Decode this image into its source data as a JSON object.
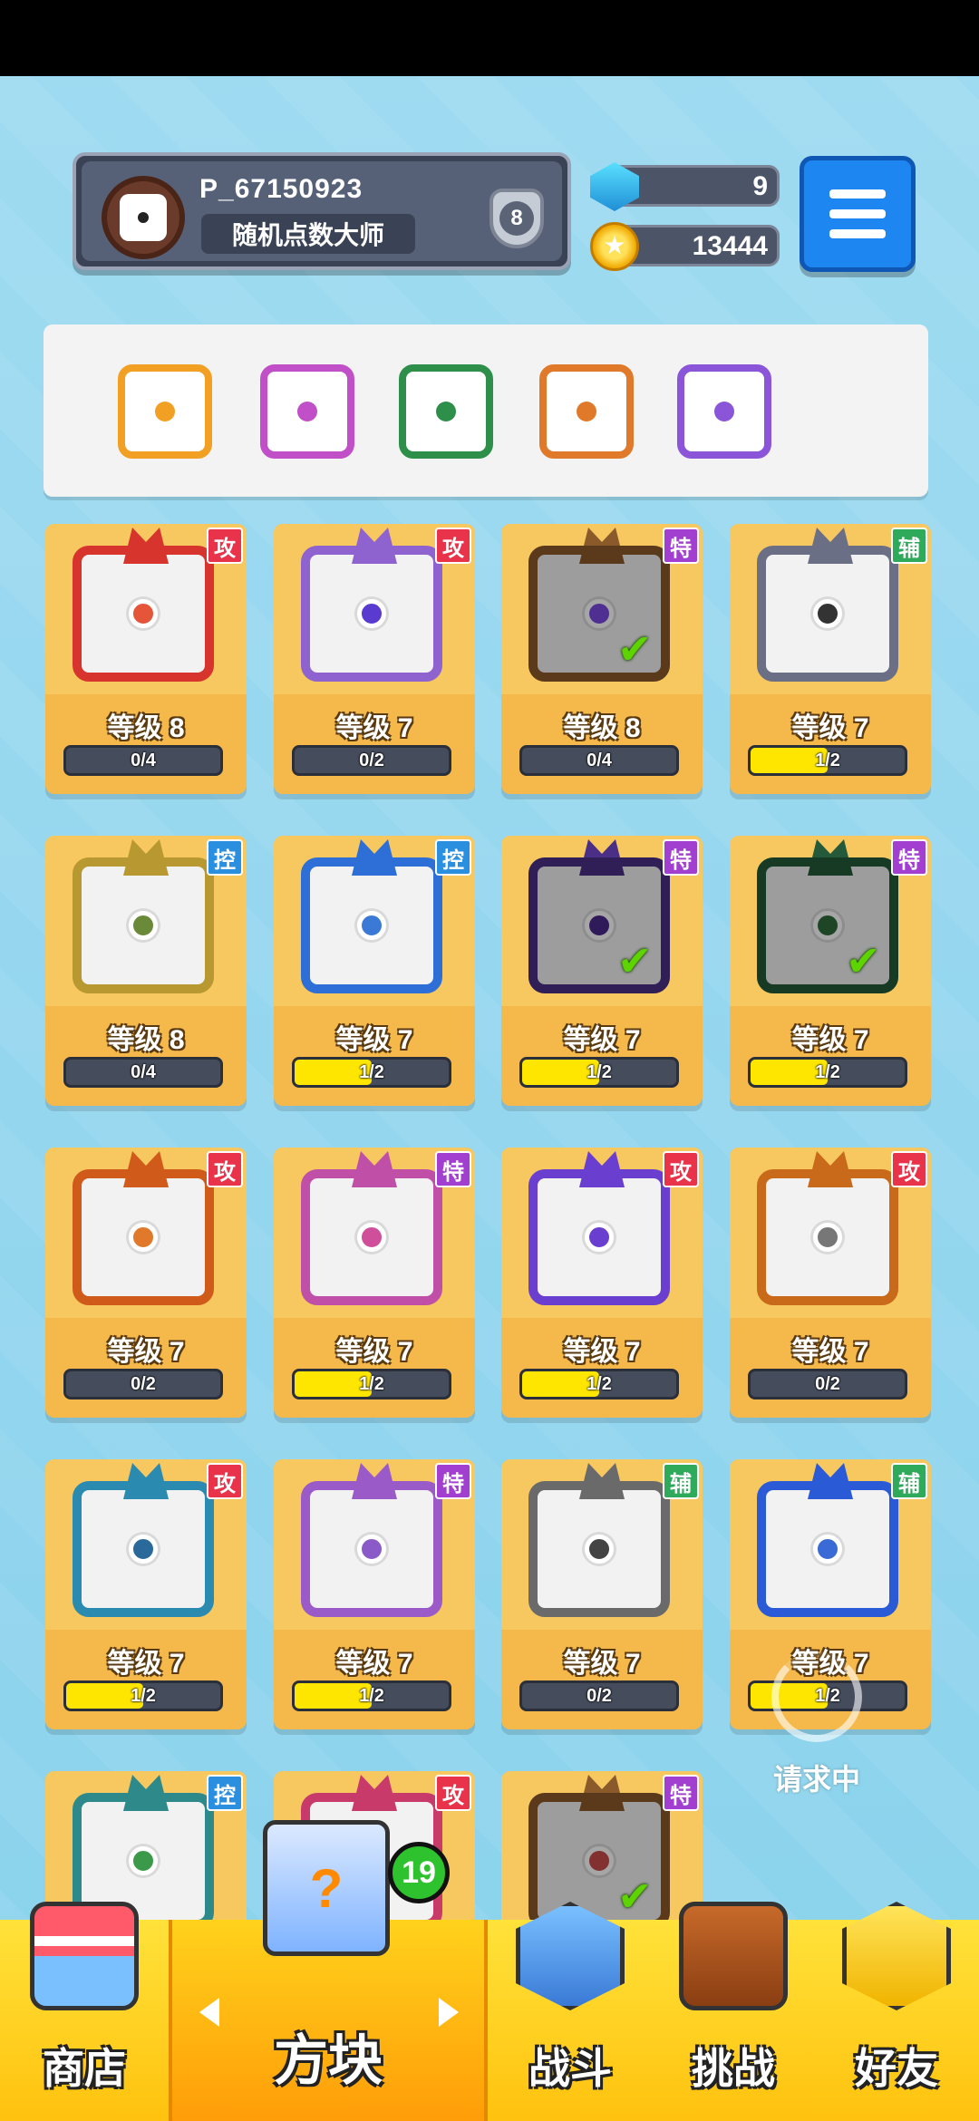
{
  "player": {
    "id": "P_67150923",
    "title": "随机点数大师",
    "rank": "8"
  },
  "currency": {
    "gems": "9",
    "coins": "13444"
  },
  "deck": [
    {
      "color": "#f2a024",
      "icon": "heart-dice-icon"
    },
    {
      "color": "#c04fc8",
      "icon": "rainbow-dice-icon"
    },
    {
      "color": "#2e8f4a",
      "icon": "pentagram-dice-icon"
    },
    {
      "color": "#e07a2a",
      "icon": "infinity-dice-icon"
    },
    {
      "color": "#8a55d8",
      "icon": "diamond-dice-icon"
    }
  ],
  "cards": [
    {
      "level": "等级 8",
      "progress": "0/4",
      "fill": 0,
      "tag": "攻",
      "tag_color": "#e8334a",
      "frame": "#d6342c",
      "core": "#e4553a",
      "checked": false,
      "icon": "star-burst-dice-icon"
    },
    {
      "level": "等级 7",
      "progress": "0/2",
      "fill": 0,
      "tag": "攻",
      "tag_color": "#e8334a",
      "frame": "#8e62cf",
      "core": "#5a3bd0",
      "checked": false,
      "icon": "magic-circle-dice-icon"
    },
    {
      "level": "等级 8",
      "progress": "0/4",
      "fill": 0,
      "tag": "特",
      "tag_color": "#a23fd0",
      "frame": "#8a5a2a",
      "core": "#7a4be0",
      "checked": true,
      "icon": "infinity-dice-icon"
    },
    {
      "level": "等级 7",
      "progress": "1/2",
      "fill": 0.5,
      "tag": "辅",
      "tag_color": "#2eaa5a",
      "frame": "#6b6f86",
      "core": "#333333",
      "checked": false,
      "icon": "jaw-dice-icon"
    },
    {
      "level": "等级 8",
      "progress": "0/4",
      "fill": 0,
      "tag": "控",
      "tag_color": "#2b8fe0",
      "frame": "#b89830",
      "core": "#6a8a3a",
      "checked": false,
      "icon": "shield-dice-icon"
    },
    {
      "level": "等级 7",
      "progress": "1/2",
      "fill": 0.5,
      "tag": "控",
      "tag_color": "#2b8fe0",
      "frame": "#2d6fd6",
      "core": "#3a7ad6",
      "checked": false,
      "icon": "snowflake-dice-icon"
    },
    {
      "level": "等级 7",
      "progress": "1/2",
      "fill": 0.5,
      "tag": "特",
      "tag_color": "#a23fd0",
      "frame": "#4b2e86",
      "core": "#4a2a8a",
      "checked": true,
      "icon": "diamond-dice-icon"
    },
    {
      "level": "等级 7",
      "progress": "1/2",
      "fill": 0.5,
      "tag": "特",
      "tag_color": "#a23fd0",
      "frame": "#245a3a",
      "core": "#2e6a3a",
      "checked": true,
      "icon": "pentagram-dice-icon"
    },
    {
      "level": "等级 7",
      "progress": "0/2",
      "fill": 0,
      "tag": "攻",
      "tag_color": "#e8334a",
      "frame": "#d05a1a",
      "core": "#e07a2a",
      "checked": false,
      "icon": "flame-dice-icon"
    },
    {
      "level": "等级 7",
      "progress": "1/2",
      "fill": 0.5,
      "tag": "特",
      "tag_color": "#a23fd0",
      "frame": "#c04fa8",
      "core": "#d04f9a",
      "checked": false,
      "icon": "syringe-dice-icon"
    },
    {
      "level": "等级 7",
      "progress": "1/2",
      "fill": 0.5,
      "tag": "攻",
      "tag_color": "#e8334a",
      "frame": "#6a3fd0",
      "core": "#6a3fd0",
      "checked": false,
      "icon": "orbit-dice-icon"
    },
    {
      "level": "等级 7",
      "progress": "0/2",
      "fill": 0,
      "tag": "攻",
      "tag_color": "#e8334a",
      "frame": "#c86a1a",
      "core": "#777777",
      "checked": false,
      "icon": "gun-dice-icon"
    },
    {
      "level": "等级 7",
      "progress": "1/2",
      "fill": 0.5,
      "tag": "攻",
      "tag_color": "#e8334a",
      "frame": "#2a8ab0",
      "core": "#2a6a9a",
      "checked": false,
      "icon": "whirlwind-dice-icon"
    },
    {
      "level": "等级 7",
      "progress": "1/2",
      "fill": 0.5,
      "tag": "特",
      "tag_color": "#a23fd0",
      "frame": "#9a5ac8",
      "core": "#8a5ac8",
      "checked": false,
      "icon": "bubble-dice-icon"
    },
    {
      "level": "等级 7",
      "progress": "0/2",
      "fill": 0,
      "tag": "辅",
      "tag_color": "#2eaa5a",
      "frame": "#6a6a6a",
      "core": "#444444",
      "checked": false,
      "icon": "clock-dice-icon"
    },
    {
      "level": "等级 7",
      "progress": "1/2",
      "fill": 0.5,
      "tag": "辅",
      "tag_color": "#2eaa5a",
      "frame": "#2a5ad6",
      "core": "#3a6ad6",
      "checked": false,
      "icon": "moon-dice-icon"
    },
    {
      "level": "",
      "progress": "",
      "fill": 0,
      "tag": "控",
      "tag_color": "#2b8fe0",
      "frame": "#2e8a8a",
      "core": "#3a9a4a",
      "checked": false,
      "icon": "wave-dice-icon"
    },
    {
      "level": "",
      "progress": "",
      "fill": 0,
      "tag": "攻",
      "tag_color": "#e8334a",
      "frame": "#c83a6a",
      "core": "#555555",
      "checked": false,
      "icon": "saw-dice-icon"
    },
    {
      "level": "",
      "progress": "",
      "fill": 0,
      "tag": "特",
      "tag_color": "#a23fd0",
      "frame": "#8a5a2a",
      "core": "#c84a4a",
      "checked": true,
      "icon": "heart-dice-icon"
    }
  ],
  "requesting": "请求中",
  "nav": {
    "shop": "商店",
    "blocks": "方块",
    "blocks_badge": "19",
    "battle": "战斗",
    "challenge": "挑战",
    "friends": "好友"
  }
}
